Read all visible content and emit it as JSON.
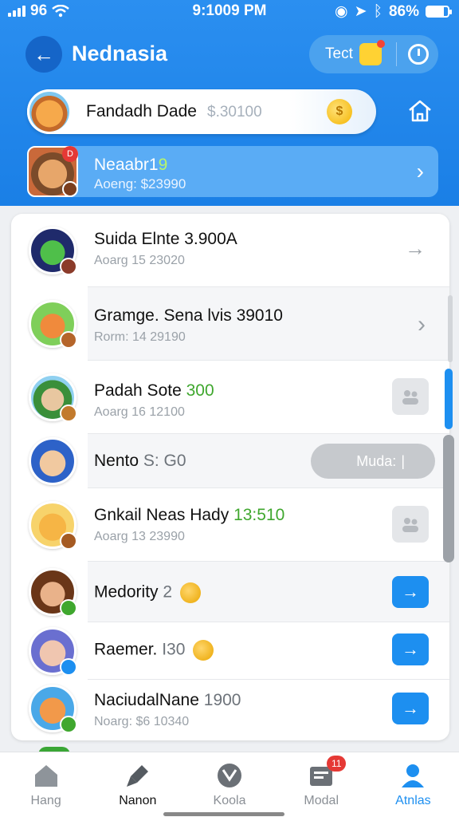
{
  "status": {
    "carrier": "96",
    "time": "9:1009 PM",
    "battery": "86%"
  },
  "header": {
    "title": "Nednasia",
    "pill_label": "Tect"
  },
  "profile": {
    "name": "Fandadh Dade",
    "amount": "$.30100"
  },
  "banner": {
    "name": "Neaabr1",
    "level": "9",
    "sub": "Aoeng: $23990"
  },
  "rows": [
    {
      "name": "Suida Elnte 3.900A",
      "sub": "Aoarg 15 23020",
      "action": "arrow"
    },
    {
      "name": "Gramge. Sena lvis 39010",
      "sub": "Rorm: 14 29190",
      "action": "arrow"
    },
    {
      "name": "Padah Sote ",
      "highlight": "300",
      "sub": "Aoarg 16 12100",
      "action": "square"
    },
    {
      "name": "Nento ",
      "grey": "S: G0",
      "action": "mode",
      "mode_label": "Muda:"
    },
    {
      "name": "Gnkail Neas Hady ",
      "highlight": "13:510",
      "sub": "Aoarg 13 23990",
      "action": "square"
    },
    {
      "name": "Medority ",
      "grey": "2",
      "coin": true,
      "action": "blue"
    },
    {
      "name": "Raemer. ",
      "grey": "I30",
      "coin": true,
      "action": "blue"
    },
    {
      "name": "NaciudalNane ",
      "grey": "1900",
      "sub": "Noarg: $6 10340",
      "action": "blue"
    }
  ],
  "tabs": [
    {
      "label": "Hang",
      "icon": "home-icon"
    },
    {
      "label": "Nanon",
      "icon": "rocket-icon"
    },
    {
      "label": "Koola",
      "icon": "ball-icon"
    },
    {
      "label": "Modal",
      "icon": "inbox-icon",
      "badge": "11"
    },
    {
      "label": "Atnlas",
      "icon": "person-icon"
    }
  ],
  "colors": {
    "primary": "#1d8ff0",
    "header": "#2b8ff0",
    "accent_green": "#3fa72e",
    "badge_red": "#e53935"
  }
}
